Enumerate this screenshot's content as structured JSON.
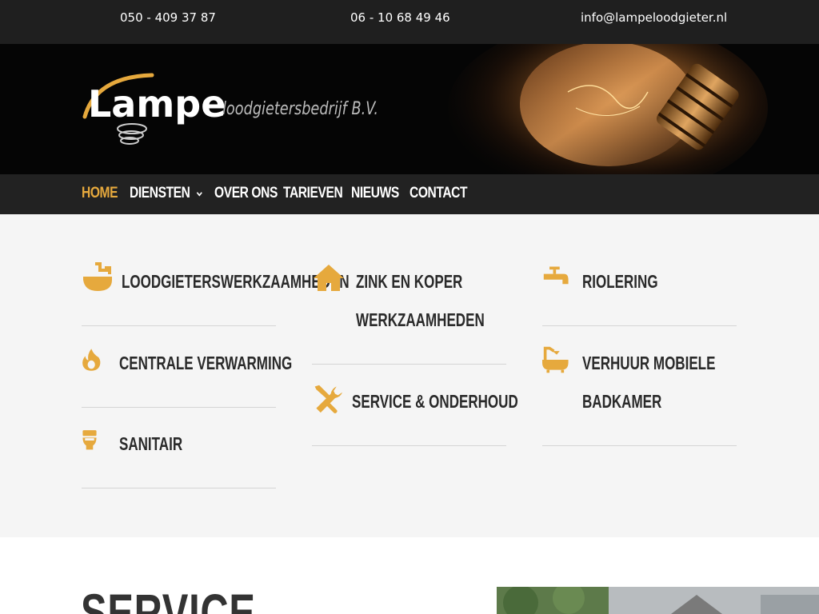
{
  "topbar": {
    "phone1": "050 - 409 37 87",
    "phone2": "06 - 10 68 49 46",
    "email": "info@lampeloodgieter.nl"
  },
  "logo": {
    "name": "Lampe",
    "tagline": "loodgietersbedrijf B.V."
  },
  "nav": {
    "items": [
      {
        "label": "HOME",
        "active": true
      },
      {
        "label": "DIENSTEN",
        "has_dropdown": true
      },
      {
        "label": "OVER ONS"
      },
      {
        "label": "TARIEVEN"
      },
      {
        "label": "NIEUWS"
      },
      {
        "label": "CONTACT"
      }
    ]
  },
  "services": {
    "col1": [
      {
        "label": "LOODGIETERSWERKZAAMHEDEN",
        "icon": "sink-icon"
      },
      {
        "label": "CENTRALE VERWARMING",
        "icon": "flame-icon"
      },
      {
        "label": "SANITAIR",
        "icon": "toilet-icon"
      }
    ],
    "col2": [
      {
        "label_line1": "ZINK EN KOPER",
        "label_line2": "WERKZAAMHEDEN",
        "icon": "house-icon"
      },
      {
        "label": "SERVICE & ONDERHOUD",
        "icon": "tools-icon"
      }
    ],
    "col3": [
      {
        "label": "RIOLERING",
        "icon": "faucet-icon"
      },
      {
        "label_line1": "VERHUUR MOBIELE",
        "label_line2": "BADKAMER",
        "icon": "bathtub-icon"
      }
    ]
  },
  "lower": {
    "heading": "SERVICE"
  },
  "colors": {
    "accent": "#e6a93d",
    "topbar_bg": "#1f1f1f",
    "nav_bg": "#222222",
    "section_bg": "#f5f5f5",
    "text_dark": "#2a2a2a"
  }
}
